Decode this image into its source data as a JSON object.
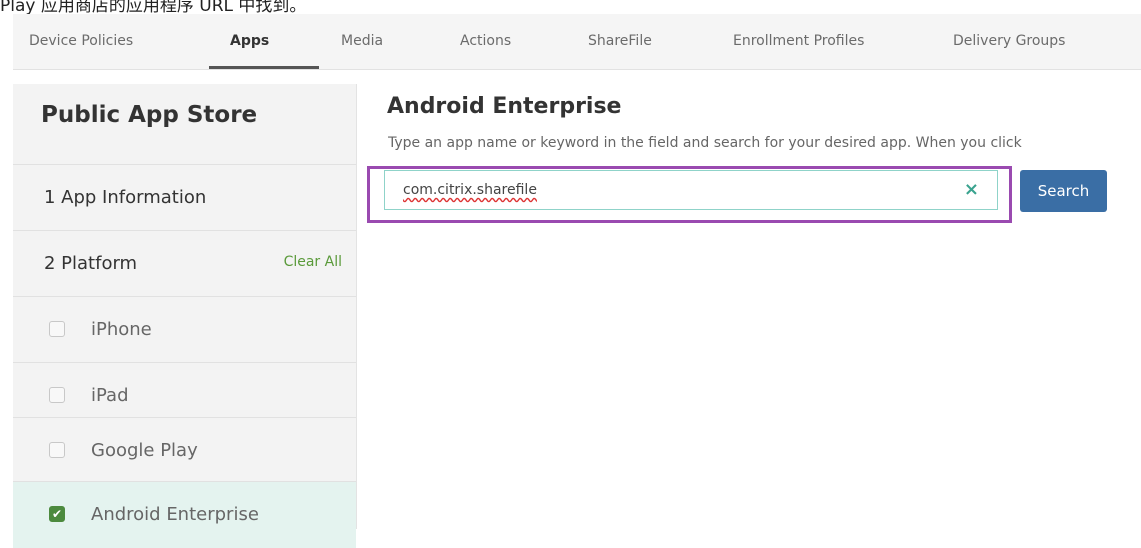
{
  "caption": "Play 应用商店的应用程序 URL 中找到。",
  "nav": {
    "tabs": [
      {
        "label": "Device Policies"
      },
      {
        "label": "Apps"
      },
      {
        "label": "Media"
      },
      {
        "label": "Actions"
      },
      {
        "label": "ShareFile"
      },
      {
        "label": "Enrollment Profiles"
      },
      {
        "label": "Delivery Groups"
      }
    ],
    "active": "Apps"
  },
  "sidebar": {
    "title": "Public App Store",
    "steps": [
      {
        "label": "1  App Information"
      },
      {
        "label": "2  Platform",
        "action": "Clear All"
      }
    ],
    "platforms": [
      {
        "label": "iPhone",
        "checked": false
      },
      {
        "label": "iPad",
        "checked": false
      },
      {
        "label": "Google Play",
        "checked": false
      },
      {
        "label": "Android Enterprise",
        "checked": true
      }
    ]
  },
  "main": {
    "title": "Android Enterprise",
    "description": "Type an app name or keyword in the field and search for your desired app. When you click",
    "search": {
      "value": "com.citrix.sharefile",
      "clear_icon": "×",
      "button_label": "Search"
    }
  },
  "colors": {
    "highlight": "#9a4ab0",
    "accent_button": "#3a6ea5",
    "checked_box": "#4c8a3e",
    "selected_row": "#e4f3ef"
  }
}
